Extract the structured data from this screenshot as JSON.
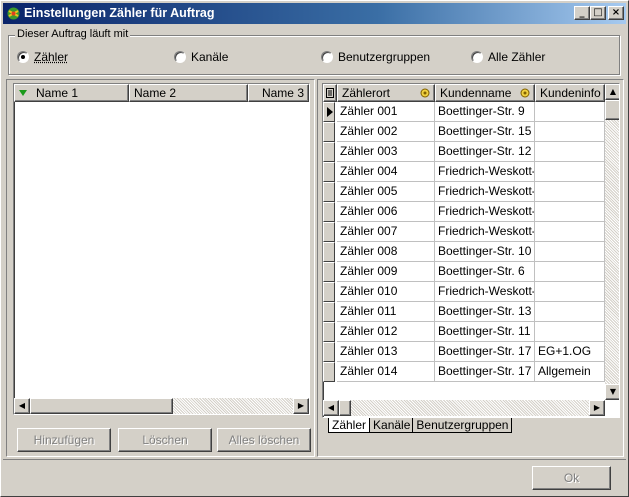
{
  "window": {
    "title": "Einstellungen Zähler für Auftrag",
    "buttons": {
      "minimize": "_",
      "maximize": "□",
      "close": "×"
    }
  },
  "runs_with": {
    "legend": "Dieser Auftrag läuft mit",
    "options": [
      {
        "label": "Zähler",
        "selected": true
      },
      {
        "label": "Kanäle",
        "selected": false
      },
      {
        "label": "Benutzergruppen",
        "selected": false
      },
      {
        "label": "Alle Zähler",
        "selected": false
      }
    ]
  },
  "left_list": {
    "columns": [
      "Name 1",
      "Name 2",
      "Name 3"
    ],
    "sort_icon": "green-triangle-down-icon",
    "rows": []
  },
  "left_buttons": {
    "add": "Hinzufügen",
    "delete": "Löschen",
    "delete_all": "Alles löschen"
  },
  "grid": {
    "columns": [
      "Zählerort",
      "Kundenname",
      "Kundeninfo"
    ],
    "rows": [
      {
        "ort": "Zähler 001",
        "name": "Boettinger-Str. 9",
        "info": ""
      },
      {
        "ort": "Zähler 002",
        "name": "Boettinger-Str. 15",
        "info": ""
      },
      {
        "ort": "Zähler 003",
        "name": "Boettinger-Str. 12",
        "info": ""
      },
      {
        "ort": "Zähler 004",
        "name": "Friedrich-Weskott-Str",
        "info": ""
      },
      {
        "ort": "Zähler 005",
        "name": "Friedrich-Weskott-Str",
        "info": ""
      },
      {
        "ort": "Zähler 006",
        "name": "Friedrich-Weskott-Str",
        "info": ""
      },
      {
        "ort": "Zähler 007",
        "name": "Friedrich-Weskott-Str",
        "info": ""
      },
      {
        "ort": "Zähler 008",
        "name": "Boettinger-Str. 10",
        "info": ""
      },
      {
        "ort": "Zähler 009",
        "name": "Boettinger-Str. 6",
        "info": ""
      },
      {
        "ort": "Zähler 010",
        "name": "Friedrich-Weskott-Str",
        "info": ""
      },
      {
        "ort": "Zähler 011",
        "name": "Boettinger-Str. 13",
        "info": ""
      },
      {
        "ort": "Zähler 012",
        "name": "Boettinger-Str. 11",
        "info": ""
      },
      {
        "ort": "Zähler 013",
        "name": "Boettinger-Str. 17",
        "info": "EG+1.OG"
      },
      {
        "ort": "Zähler 014",
        "name": "Boettinger-Str. 17",
        "info": "Allgemein"
      }
    ]
  },
  "grid_tabs": [
    "Zähler",
    "Kanäle",
    "Benutzergruppen"
  ],
  "ok_button": "Ok",
  "colors": {
    "title_start": "#0a246a",
    "title_end": "#a6caf0",
    "face": "#d4d0c8",
    "sort_icon": "#1a9a1a",
    "key_icon": "#c8a000"
  }
}
